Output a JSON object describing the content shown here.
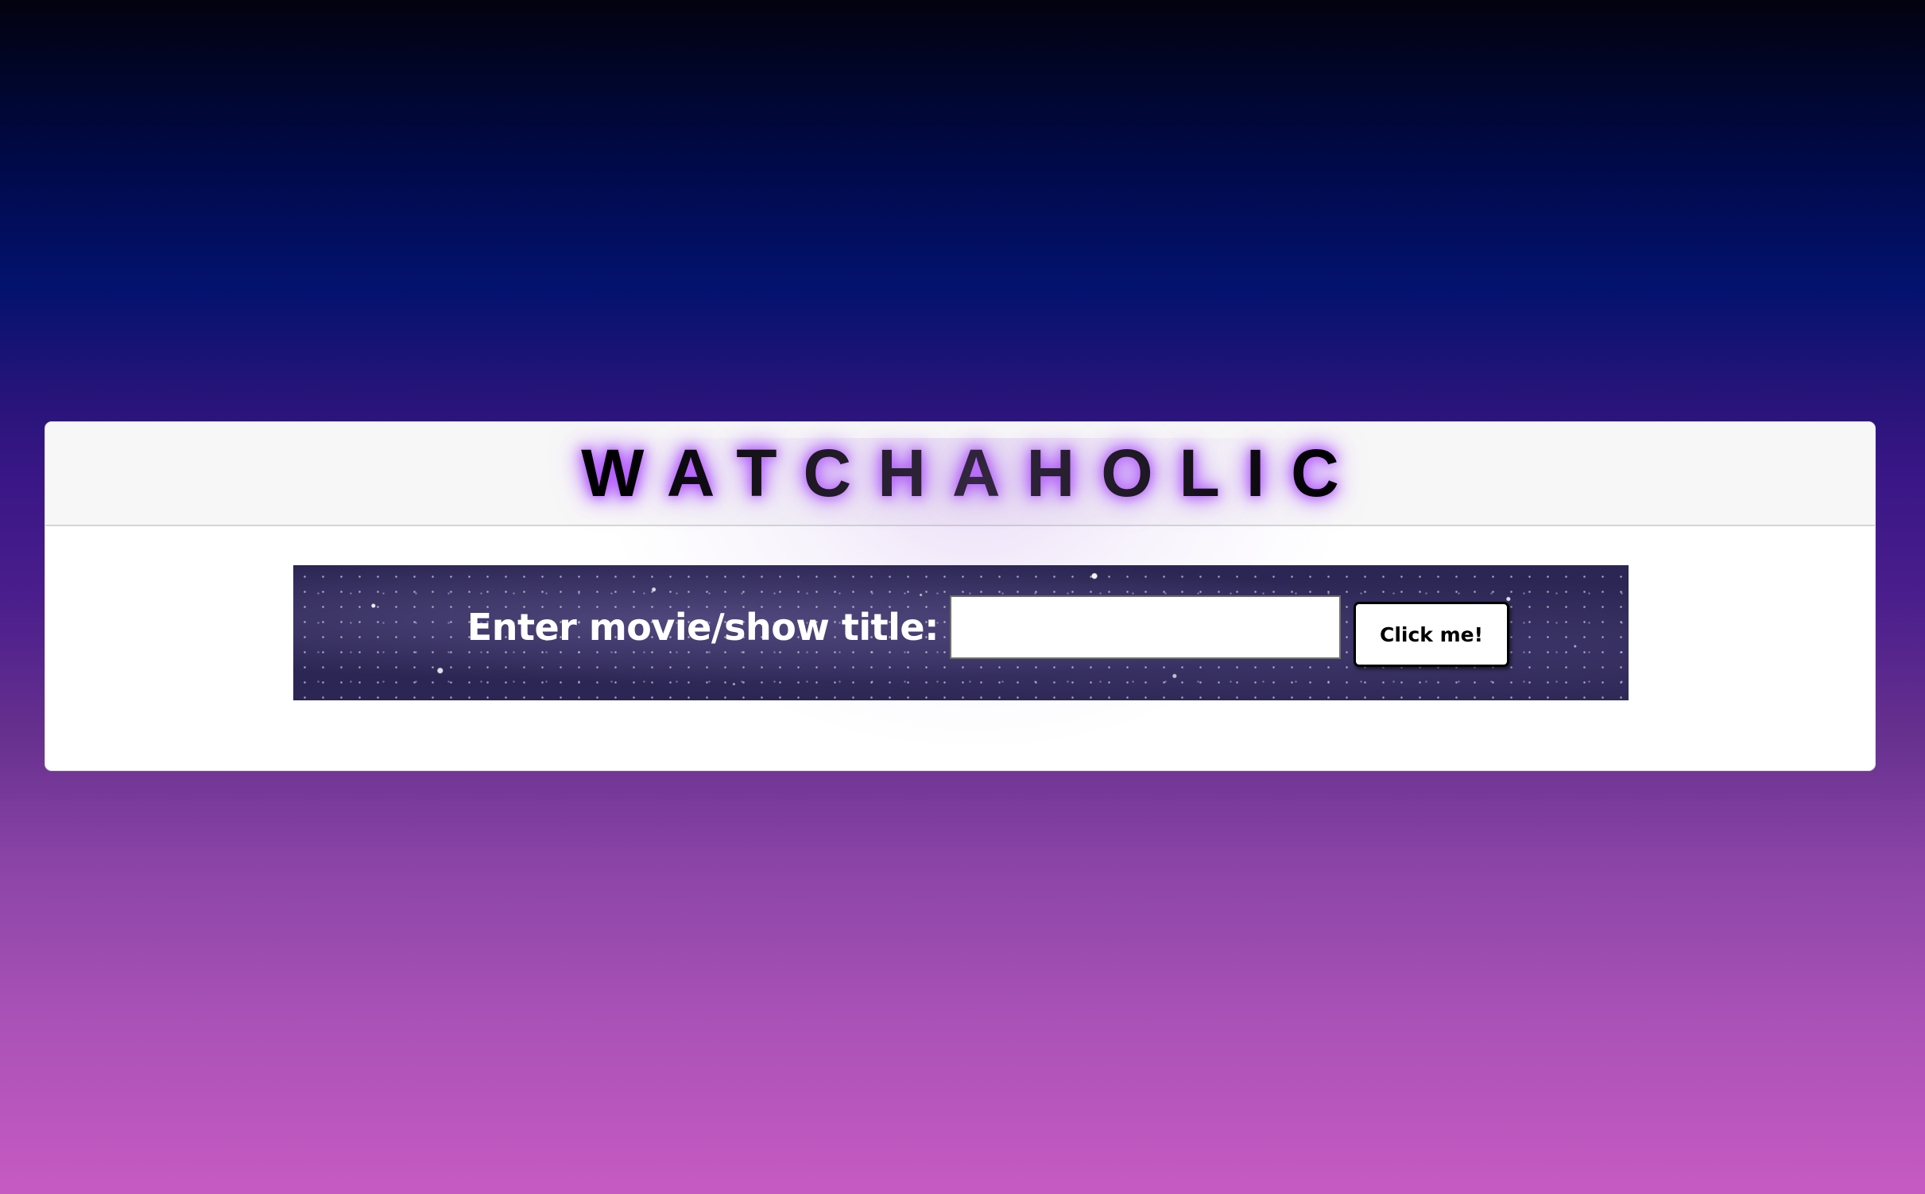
{
  "header": {
    "title": "WATCHAHOLIC"
  },
  "search": {
    "label": "Enter movie/show title:",
    "input_value": "",
    "placeholder": "",
    "button_label": "Click me!"
  },
  "colors": {
    "title_glow": "#a040ff",
    "button_border": "#000000",
    "background_top": "#02020f",
    "background_bottom": "#c65ac3"
  }
}
